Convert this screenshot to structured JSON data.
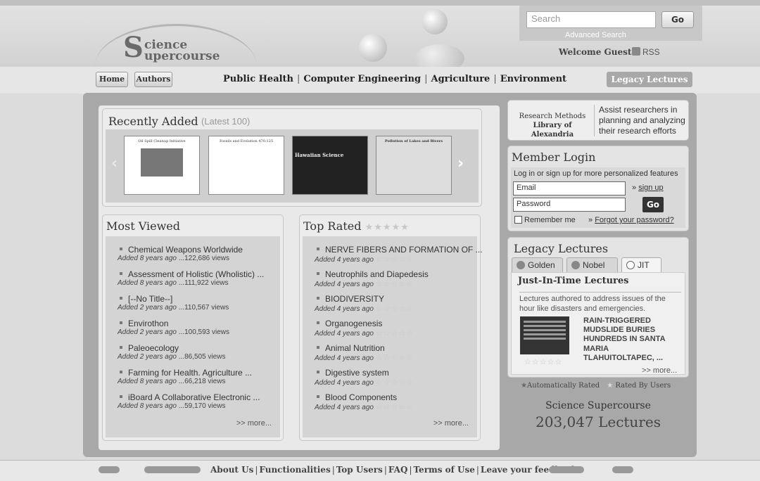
{
  "header": {
    "logo_letter": "S",
    "logo_word1": "cience",
    "logo_word2": "upercourse",
    "search_placeholder": "Search",
    "search_go": "Go",
    "advanced_search": "Advanced Search",
    "welcome": "Welcome Guest",
    "rss": "RSS"
  },
  "nav": {
    "home": "Home",
    "authors": "Authors",
    "topics": [
      "Public Health",
      "Computer Engineering",
      "Agriculture",
      "Environment"
    ],
    "legacy": "Legacy Lectures"
  },
  "recent": {
    "title": "Recently Added",
    "subtitle": "(Latest 100)",
    "thumbs": [
      {
        "text": "Oil Spill Cleanup Initiative"
      },
      {
        "text": "Fossils and Evolution 470.125"
      },
      {
        "text": "Hawaiian Science"
      },
      {
        "text": "Pollution of Lakes and Rivers"
      }
    ]
  },
  "most_viewed": {
    "title": "Most Viewed",
    "items": [
      {
        "name": "Chemical Weapons Worldwide",
        "added": "Added 8 years ago",
        "views": "...122,686 views"
      },
      {
        "name": "Assessment of Holistic (Wholistic) ...",
        "added": "Added 8 years ago",
        "views": "...111,922 views"
      },
      {
        "name": "[--No Title--]",
        "added": "Added 2 years ago",
        "views": "...110,567 views"
      },
      {
        "name": "Envirothon",
        "added": "Added 2 years ago",
        "views": "...100,593 views"
      },
      {
        "name": "Paleoecology",
        "added": "Added 2 years ago",
        "views": "...86,505 views"
      },
      {
        "name": "Farming for Health. Agriculture ...",
        "added": "Added 8 years ago",
        "views": "...66,218 views"
      },
      {
        "name": "iBoard A Collaborative Electronic ...",
        "added": "Added 8 years ago",
        "views": "...59,170 views"
      }
    ],
    "more": ">> more..."
  },
  "top_rated": {
    "title": "Top Rated",
    "items": [
      {
        "name": "NERVE FIBERS AND FORMATION OF ...",
        "added": "Added 4 years ago"
      },
      {
        "name": "Neutrophils and Diapedesis",
        "added": "Added 4 years ago"
      },
      {
        "name": "BIODIVERSITY",
        "added": "Added 4 years ago"
      },
      {
        "name": "Organogenesis",
        "added": "Added 4 years ago"
      },
      {
        "name": "Animal Nutrition",
        "added": "Added 4 years ago"
      },
      {
        "name": "Digestive system",
        "added": "Added 4 years ago"
      },
      {
        "name": "Blood Components",
        "added": "Added 4 years ago"
      }
    ],
    "more": ">> more..."
  },
  "research": {
    "library_line1": "Research Methods",
    "library_line2": "Library of Alexandria",
    "description": "Assist researchers in planning and analyzing their research efforts"
  },
  "login": {
    "title": "Member Login",
    "subtitle": "Log in or sign up for more personalized features",
    "email_value": "Email",
    "password_value": "Password",
    "signup": "sign up",
    "go": "Go",
    "remember": "Remember me",
    "forgot": "Forgot your password?"
  },
  "legacy": {
    "title": "Legacy Lectures",
    "tabs": [
      "Golden",
      "Nobel",
      "JIT"
    ],
    "jit_title": "Just-In-Time Lectures",
    "jit_desc": "Lectures authored to address issues of the hour like disasters and emergencies.",
    "jit_headline": "RAIN-TRIGGERED MUDSLIDE BURIES HUNDREDS IN SANTA MARIA TLAHUITOLTAPEC, ...",
    "more": ">> more..."
  },
  "legend": {
    "auto": "Automatically Rated",
    "users": "Rated By Users"
  },
  "stats": {
    "label": "Science Supercourse",
    "value": "203,047 Lectures"
  },
  "footer": {
    "links": [
      "About Us",
      "Functionalities",
      "Top Users",
      "FAQ",
      "Terms of Use",
      "Leave your feedback"
    ]
  }
}
